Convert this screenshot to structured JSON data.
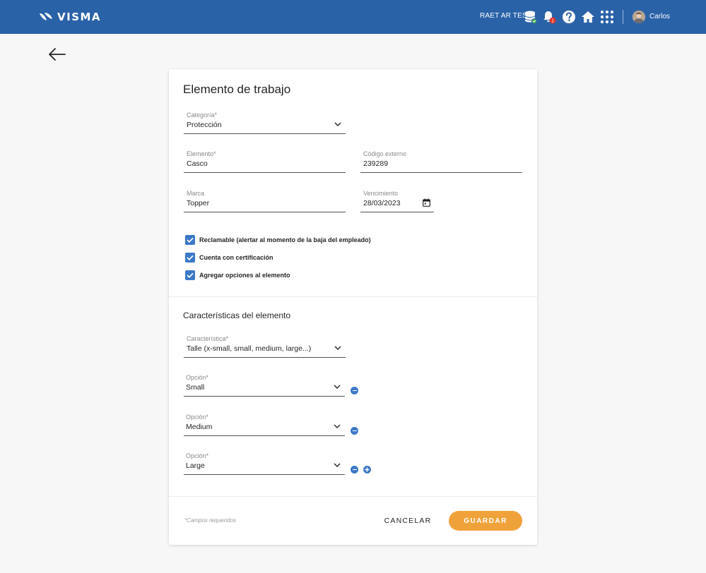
{
  "header": {
    "brand": "VISMA",
    "environment": "RAET AR TEST",
    "notification_count": "1",
    "user_name": "Carlos"
  },
  "form": {
    "title": "Elemento de trabajo",
    "category": {
      "label": "Categoría*",
      "value": "Protección"
    },
    "element": {
      "label": "Elemento*",
      "value": "Casco"
    },
    "external_code": {
      "label": "Código externo",
      "value": "239289"
    },
    "brand": {
      "label": "Marca",
      "value": "Topper"
    },
    "expiry": {
      "label": "Vencimiento",
      "value": "28/03/2023"
    },
    "checkboxes": [
      {
        "label": "Reclamable (alertar al momento de la baja del empleado)",
        "checked": true
      },
      {
        "label": "Cuenta con certificación",
        "checked": true
      },
      {
        "label": "Agregar opciones al elemento",
        "checked": true
      }
    ]
  },
  "characteristics": {
    "title": "Características del elemento",
    "characteristic": {
      "label": "Característica*",
      "value": "Talle (x-small, small, medium, large...)"
    },
    "options": [
      {
        "label": "Opción*",
        "value": "Small"
      },
      {
        "label": "Opción*",
        "value": "Medium"
      },
      {
        "label": "Opción*",
        "value": "Large"
      }
    ]
  },
  "footer": {
    "required_note": "*Campos requeridos",
    "cancel_label": "CANCELAR",
    "save_label": "GUARDAR"
  },
  "colors": {
    "topbar": "#2a62a8",
    "accent": "#3b78c8",
    "primary_button": "#f0a23a",
    "notification_badge": "#e0362b",
    "status_ok": "#4caf50"
  }
}
